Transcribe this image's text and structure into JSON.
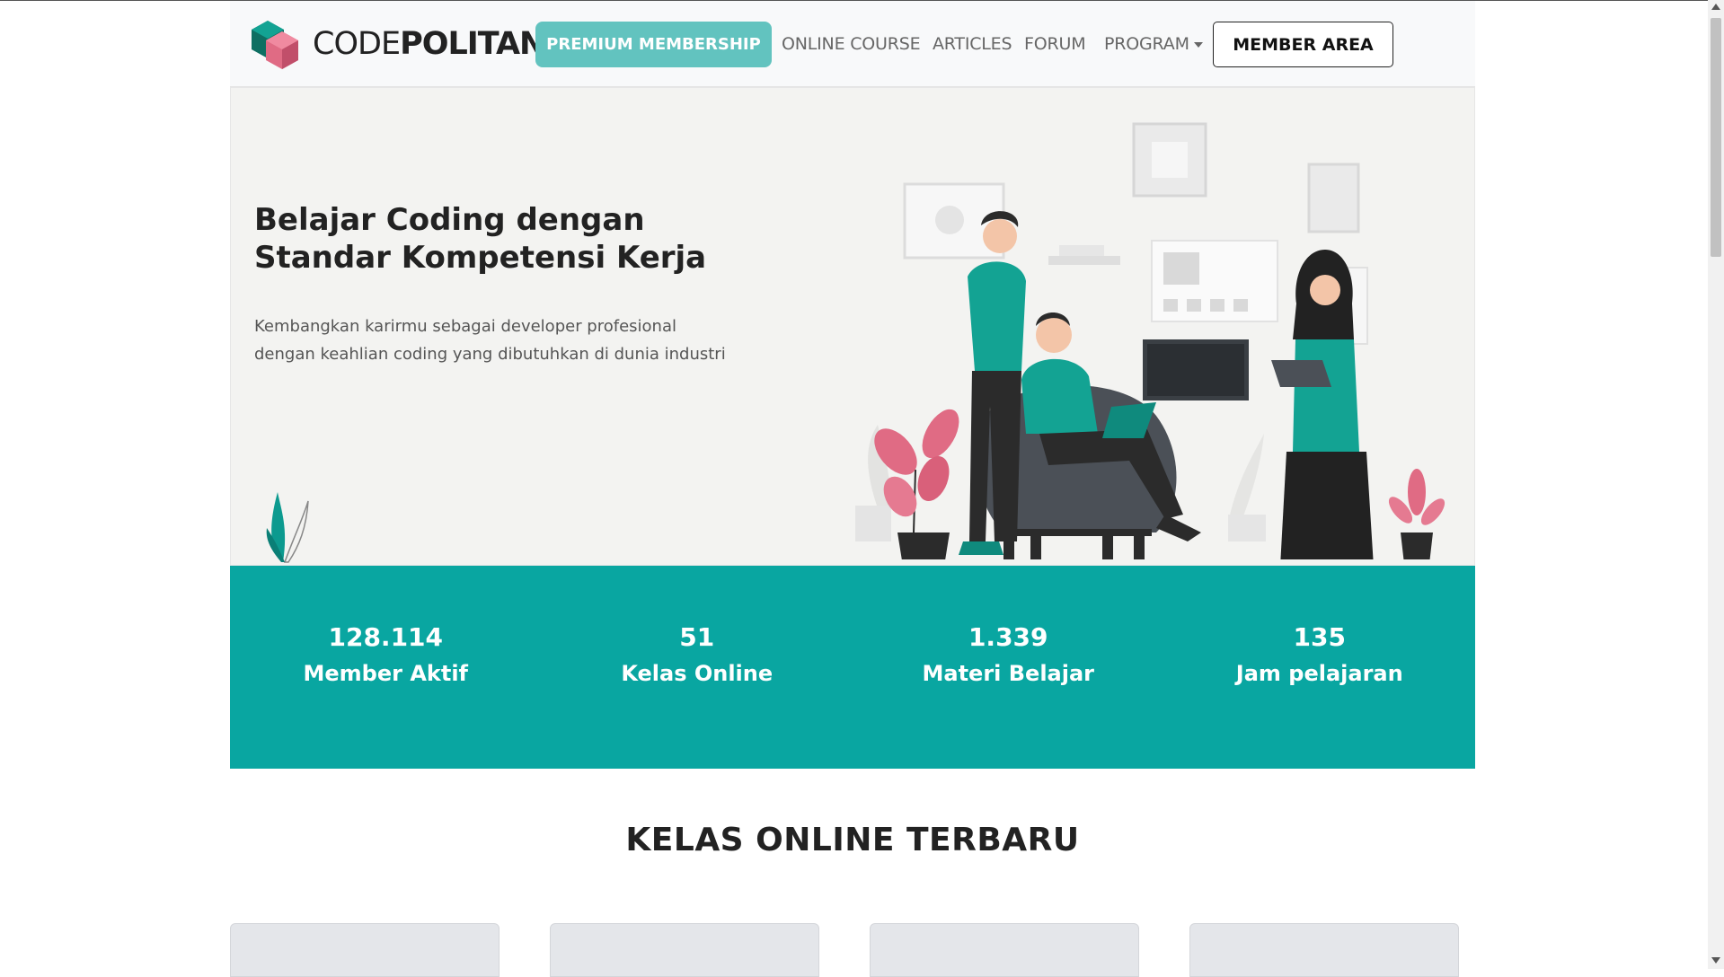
{
  "navbar": {
    "brand_light": "CODE",
    "brand_bold": "POLITAN",
    "premium": "PREMIUM MEMBERSHIP",
    "links": [
      "ONLINE COURSE",
      "ARTICLES",
      "FORUM",
      "PROGRAM"
    ],
    "member_area": "MEMBER AREA"
  },
  "hero": {
    "title_line1": "Belajar Coding dengan",
    "title_line2": "Standar Kompetensi Kerja",
    "subtitle_line1": "Kembangkan karirmu sebagai developer profesional",
    "subtitle_line2": "dengan keahlian coding yang dibutuhkan di dunia industri"
  },
  "stats": [
    {
      "value": "128.114",
      "label": "Member Aktif"
    },
    {
      "value": "51",
      "label": "Kelas Online"
    },
    {
      "value": "1.339",
      "label": "Materi Belajar"
    },
    {
      "value": "135",
      "label": "Jam pelajaran"
    }
  ],
  "section": {
    "title": "KELAS ONLINE TERBARU"
  },
  "colors": {
    "teal": "#09a6a1",
    "premium_button": "#62c3bf",
    "hero_bg": "#f3f3f1",
    "accent_pink": "#e06b84"
  },
  "icons": [
    "codepolitan-logo-icon",
    "dropdown-caret-icon"
  ]
}
